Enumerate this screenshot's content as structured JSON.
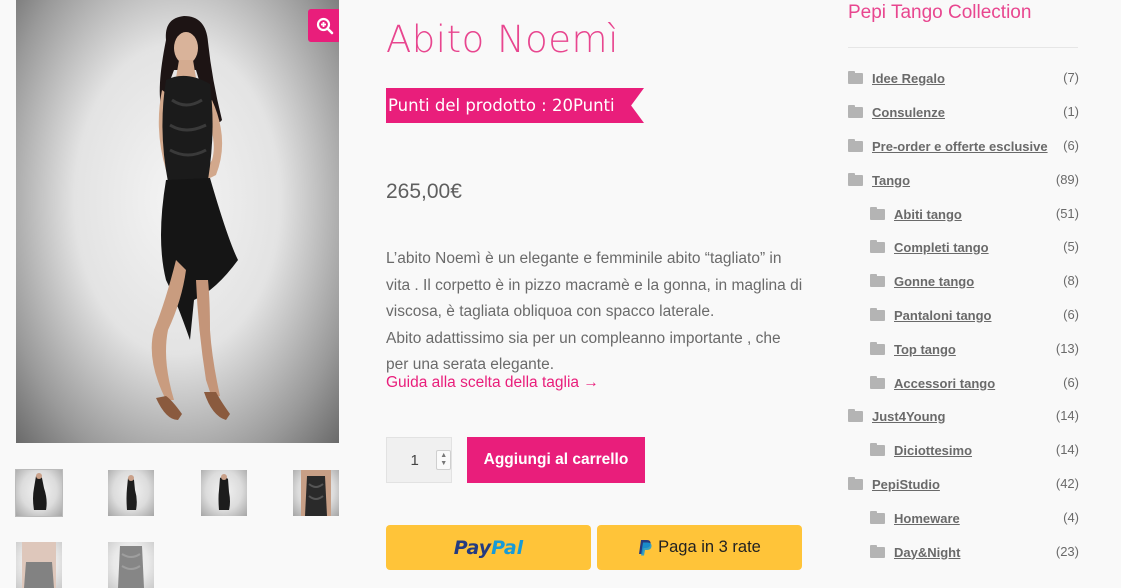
{
  "product": {
    "title": "Abito Noemì",
    "points_banner": "Punti del prodotto : 20Punti",
    "price": "265,00€",
    "description": [
      "L’abito Noemì è un elegante e femminile abito  “tagliato” in vita . Il corpetto è in pizzo macramè e la gonna, in maglina di viscosa, è tagliata obliquoa con spacco laterale.",
      "Abito adattissimo sia per un compleanno importante , che per una serata elegante."
    ],
    "size_guide_link": "Guida alla scelta della taglia →",
    "quantity": "1",
    "add_to_cart_label": "Aggiungi al carrello",
    "paypal_left": "Pay",
    "paypal_right": "Pal",
    "pay_in_3_label": "Paga in 3 rate"
  },
  "gallery": {
    "zoom_icon": "zoom-in-icon",
    "thumbnails": [
      "thumbnail-1",
      "thumbnail-2",
      "thumbnail-3",
      "thumbnail-4",
      "thumbnail-5",
      "thumbnail-6"
    ]
  },
  "sidebar": {
    "title": "Pepi Tango Collection",
    "categories": [
      {
        "label": "Idee Regalo",
        "count": "(7)",
        "level": 0
      },
      {
        "label": "Consulenze",
        "count": "(1)",
        "level": 0
      },
      {
        "label": "Pre-order e offerte esclusive",
        "count": "(6)",
        "level": 0
      },
      {
        "label": "Tango",
        "count": "(89)",
        "level": 0
      },
      {
        "label": "Abiti tango",
        "count": "(51)",
        "level": 1
      },
      {
        "label": "Completi tango",
        "count": "(5)",
        "level": 1
      },
      {
        "label": "Gonne tango",
        "count": "(8)",
        "level": 1
      },
      {
        "label": "Pantaloni tango",
        "count": "(6)",
        "level": 1
      },
      {
        "label": "Top tango",
        "count": "(13)",
        "level": 1
      },
      {
        "label": "Accessori tango",
        "count": "(6)",
        "level": 1
      },
      {
        "label": "Just4Young",
        "count": "(14)",
        "level": 0
      },
      {
        "label": "Diciottesimo",
        "count": "(14)",
        "level": 1
      },
      {
        "label": "PepiStudio",
        "count": "(42)",
        "level": 0
      },
      {
        "label": "Homeware",
        "count": "(4)",
        "level": 1
      },
      {
        "label": "Day&Night",
        "count": "(23)",
        "level": 1
      }
    ]
  },
  "colors": {
    "accent": "#e91e7b",
    "paypal_yellow": "#ffc439",
    "text": "#6d6d6d"
  }
}
